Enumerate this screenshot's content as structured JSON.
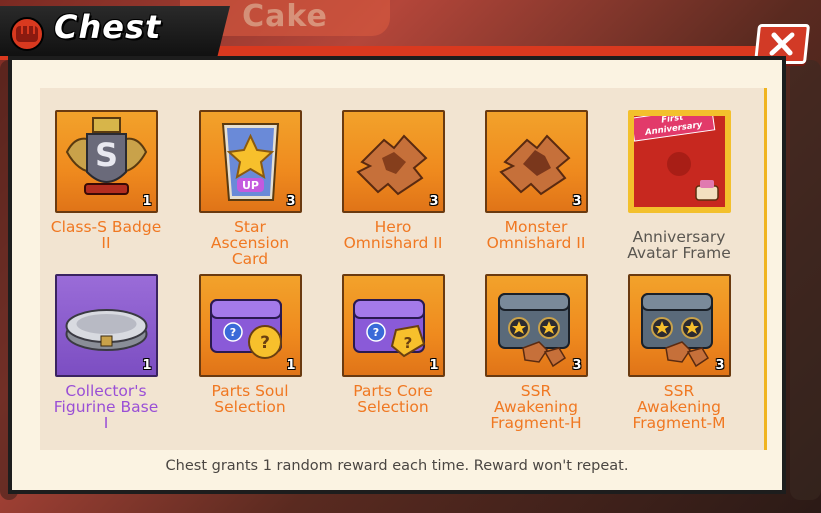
{
  "background_text": "Cake",
  "header": {
    "title": "Chest",
    "close_label": "X"
  },
  "items": [
    {
      "name": "Class-S Badge II",
      "lines": [
        "Class-S Badge",
        "II"
      ],
      "qty": "1",
      "icon": "class-s-badge-icon",
      "frame": "orange",
      "label_color": "orange"
    },
    {
      "name": "Star Ascension Card",
      "lines": [
        "Star",
        "Ascension",
        "Card"
      ],
      "qty": "3",
      "icon": "star-ascension-card-icon",
      "frame": "orange",
      "label_color": "orange"
    },
    {
      "name": "Hero Omnishard II",
      "lines": [
        "Hero",
        "Omnishard II"
      ],
      "qty": "3",
      "icon": "hero-omnishard-icon",
      "frame": "orange",
      "label_color": "orange"
    },
    {
      "name": "Monster Omnishard II",
      "lines": [
        "Monster",
        "Omnishard II"
      ],
      "qty": "3",
      "icon": "monster-omnishard-icon",
      "frame": "orange",
      "label_color": "orange"
    },
    {
      "name": "Anniversary Avatar Frame",
      "lines": [
        "Anniversary",
        "Avatar Frame"
      ],
      "qty": "",
      "icon": "anniversary-avatar-frame-icon",
      "frame": "red",
      "label_color": "gray",
      "badge_text": "First Anniversary"
    },
    {
      "name": "Collector's Figurine Base I",
      "lines": [
        "Collector's",
        "Figurine Base",
        "I"
      ],
      "qty": "1",
      "icon": "figurine-base-icon",
      "frame": "purple",
      "label_color": "purple"
    },
    {
      "name": "Parts Soul Selection",
      "lines": [
        "Parts Soul",
        "Selection"
      ],
      "qty": "1",
      "icon": "parts-soul-chest-icon",
      "frame": "orange",
      "label_color": "orange"
    },
    {
      "name": "Parts Core Selection",
      "lines": [
        "Parts Core",
        "Selection"
      ],
      "qty": "1",
      "icon": "parts-core-chest-icon",
      "frame": "orange",
      "label_color": "orange"
    },
    {
      "name": "SSR Awakening Fragment-H",
      "lines": [
        "SSR",
        "Awakening",
        "Fragment-H"
      ],
      "qty": "3",
      "icon": "ssr-fragment-chest-icon",
      "frame": "orange",
      "label_color": "orange"
    },
    {
      "name": "SSR Awakening Fragment-M",
      "lines": [
        "SSR",
        "Awakening",
        "Fragment-M"
      ],
      "qty": "3",
      "icon": "ssr-fragment-chest-icon",
      "frame": "orange",
      "label_color": "orange"
    }
  ],
  "footer": {
    "note": "Chest grants 1 random reward each time. Reward won't repeat."
  },
  "colors": {
    "accent_red": "#d9391f",
    "label_orange": "#f07822",
    "label_purple": "#9a4fd6",
    "tile_orange": "#f2a22b"
  }
}
